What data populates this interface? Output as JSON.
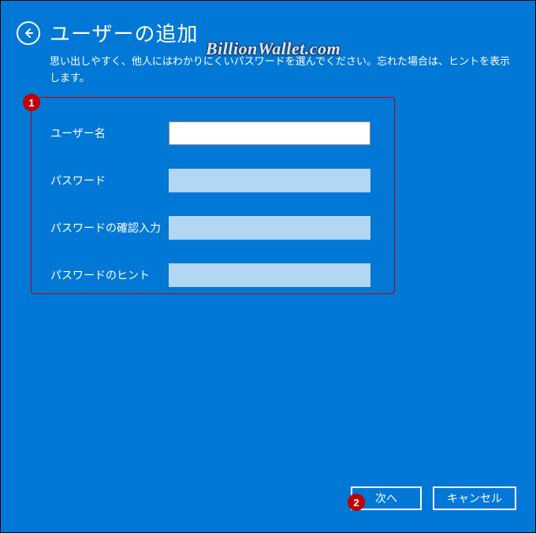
{
  "header": {
    "title": "ユーザーの追加",
    "subtitle": "思い出しやすく、他人にはわかりにくいパスワードを選んでください。忘れた場合は、ヒントを表示します。"
  },
  "watermark": "BillionWallet.com",
  "form": {
    "username": {
      "label": "ユーザー名",
      "value": ""
    },
    "password": {
      "label": "パスワード",
      "value": ""
    },
    "password_confirm": {
      "label": "パスワードの確認入力",
      "value": ""
    },
    "password_hint": {
      "label": "パスワードのヒント",
      "value": ""
    }
  },
  "callouts": {
    "one": "1",
    "two": "2"
  },
  "footer": {
    "next": "次へ",
    "cancel": "キャンセル"
  }
}
